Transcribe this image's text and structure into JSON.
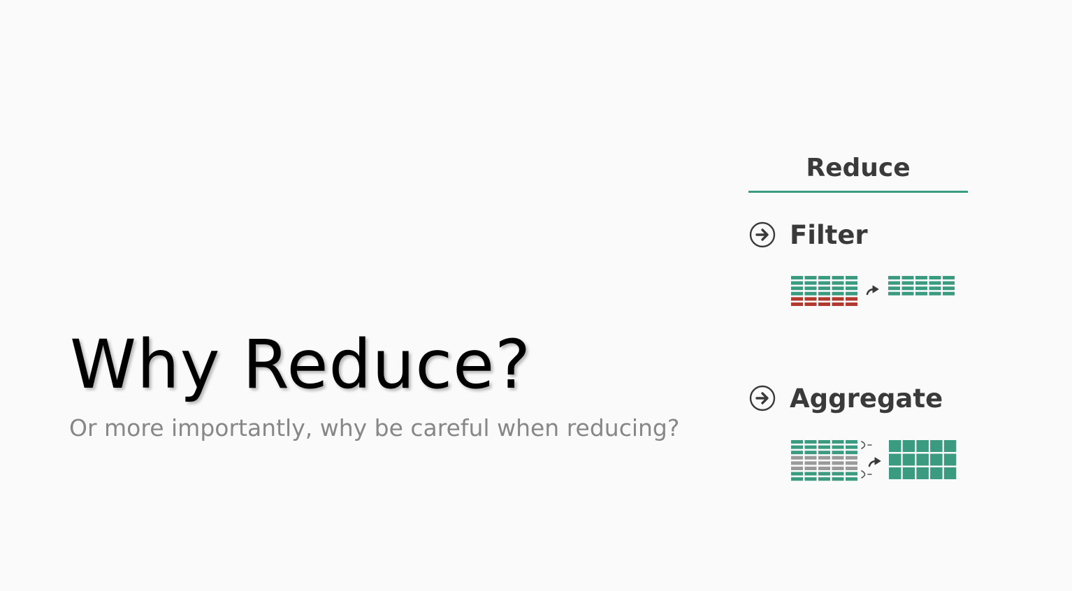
{
  "slide": {
    "title": "Why Reduce?",
    "subtitle": "Or more importantly, why be careful when reducing?"
  },
  "panel": {
    "heading": "Reduce",
    "accent_color": "#3a9b80",
    "removed_color": "#b03a2e",
    "grouped_color": "#9a9a9a",
    "sections": [
      {
        "label": "Filter",
        "icon": "circle-arrow-right-icon"
      },
      {
        "label": "Aggregate",
        "icon": "circle-arrow-right-icon"
      }
    ]
  }
}
